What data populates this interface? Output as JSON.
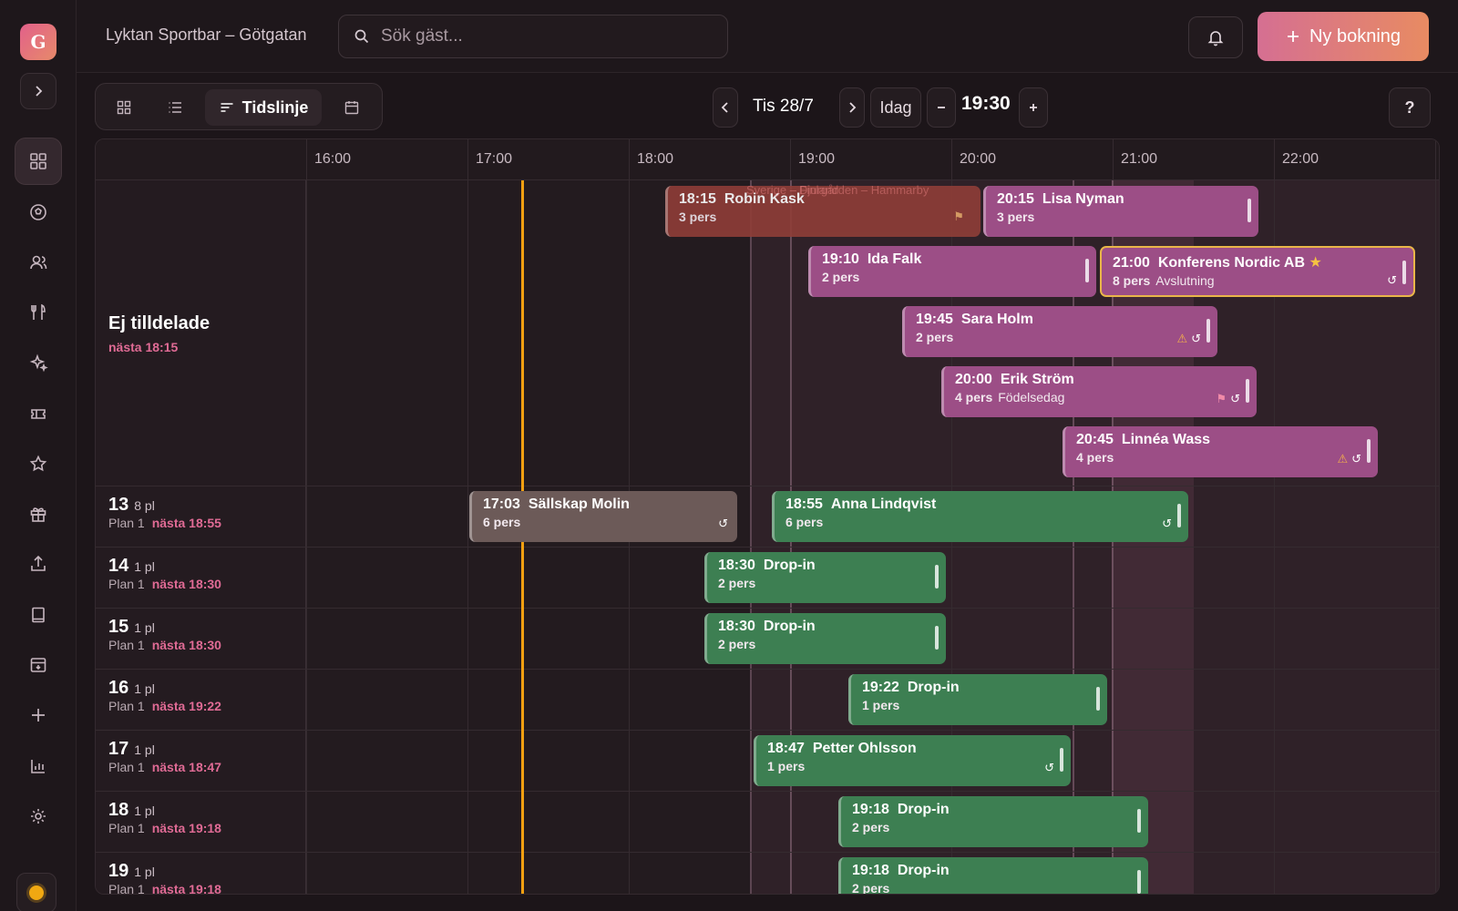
{
  "app": {
    "avatar_letter": "G",
    "venue": "Lyktan Sportbar – Götgatan"
  },
  "search": {
    "placeholder": "Sök gäst..."
  },
  "header": {
    "new_booking_label": "Ny bokning"
  },
  "views": {
    "active_label": "Tidslinje"
  },
  "nav": {
    "date": "Tis 28/7",
    "today": "Idag",
    "time": "19:30",
    "help": "?"
  },
  "timeline": {
    "hours": [
      "16:00",
      "17:00",
      "18:00",
      "19:00",
      "20:00",
      "21:00",
      "22:00"
    ]
  },
  "rows": {
    "unassigned": {
      "title": "Ej tilldelade",
      "next": "nästa 18:15"
    },
    "tables": [
      {
        "num": "13",
        "cap": "8 pl",
        "plan": "Plan 1",
        "next": "nästa 18:55"
      },
      {
        "num": "14",
        "cap": "1 pl",
        "plan": "Plan 1",
        "next": "nästa 18:30"
      },
      {
        "num": "15",
        "cap": "1 pl",
        "plan": "Plan 1",
        "next": "nästa 18:30"
      },
      {
        "num": "16",
        "cap": "1 pl",
        "plan": "Plan 1",
        "next": "nästa 19:22"
      },
      {
        "num": "17",
        "cap": "1 pl",
        "plan": "Plan 1",
        "next": "nästa 18:47"
      },
      {
        "num": "18",
        "cap": "1 pl",
        "plan": "Plan 1",
        "next": "nästa 19:18"
      },
      {
        "num": "19",
        "cap": "1 pl",
        "plan": "Plan 1",
        "next": "nästa 19:18"
      }
    ]
  },
  "overlay": {
    "match": "Sverige – Finland",
    "match2": "Djurgården – Hammarby"
  },
  "bookings": [
    {
      "time": "18:15",
      "name": "Robin Kask",
      "pers": "3 pers",
      "note": ""
    },
    {
      "time": "20:15",
      "name": "Lisa Nyman",
      "pers": "3 pers",
      "note": ""
    },
    {
      "time": "19:10",
      "name": "Ida Falk",
      "pers": "2 pers",
      "note": ""
    },
    {
      "time": "21:00",
      "name": "Konferens Nordic AB",
      "pers": "8 pers",
      "note": "Avslutning"
    },
    {
      "time": "19:45",
      "name": "Sara Holm",
      "pers": "2 pers",
      "note": ""
    },
    {
      "time": "20:00",
      "name": "Erik Ström",
      "pers": "4 pers",
      "note": "Födelsedag"
    },
    {
      "time": "20:45",
      "name": "Linnéa Wass",
      "pers": "4 pers",
      "note": ""
    },
    {
      "time": "17:03",
      "name": "Sällskap Molin",
      "pers": "6 pers",
      "note": ""
    },
    {
      "time": "18:55",
      "name": "Anna Lindqvist",
      "pers": "6 pers",
      "note": ""
    },
    {
      "time": "18:30",
      "name": "Drop-in",
      "pers": "2 pers",
      "note": ""
    },
    {
      "time": "18:30",
      "name": "Drop-in",
      "pers": "2 pers",
      "note": ""
    },
    {
      "time": "19:22",
      "name": "Drop-in",
      "pers": "1 pers",
      "note": ""
    },
    {
      "time": "18:47",
      "name": "Petter Ohlsson",
      "pers": "1 pers",
      "note": ""
    },
    {
      "time": "19:18",
      "name": "Drop-in",
      "pers": "2 pers",
      "note": ""
    },
    {
      "time": "19:18",
      "name": "Drop-in",
      "pers": "2 pers",
      "note": ""
    }
  ],
  "colors": {
    "accent": "#e06b95",
    "now_line": "#f2a011",
    "seated": "#3d7f52",
    "unassigned": "#9c4e86",
    "late": "#8f3e38",
    "done": "#6c5a58"
  }
}
